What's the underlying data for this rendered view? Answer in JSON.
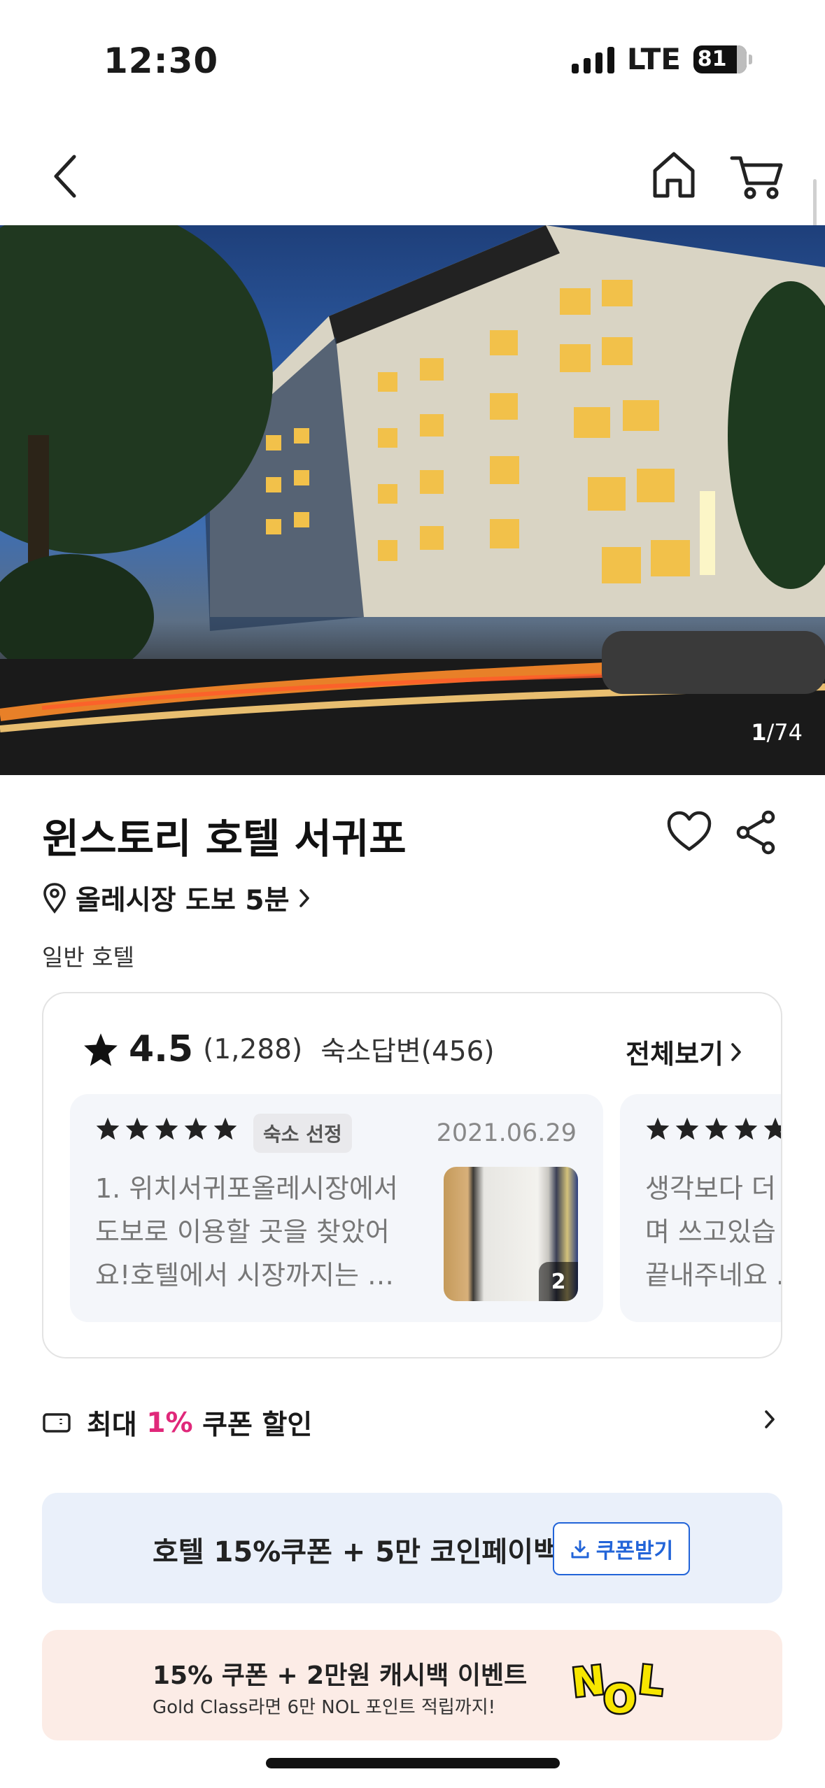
{
  "status_bar": {
    "time": "12:30",
    "network": "LTE",
    "battery": "81"
  },
  "hero": {
    "counter_current": "1",
    "counter_total": "/74"
  },
  "hotel": {
    "name": "윈스토리 호텔 서귀포",
    "location": "올레시장 도보 5분",
    "type": "일반 호텔"
  },
  "reviews": {
    "rating": "4.5",
    "count": "(1,288)",
    "replies": "숙소답변(456)",
    "view_all": "전체보기",
    "items": [
      {
        "badge": "숙소 선정",
        "date": "2021.06.29",
        "text": "1. 위치서귀포올레시장에서 도보로 이용할 곳을 찾았어요!호텔에서 시장까지는 …",
        "photo_count": "2",
        "stars": 5
      },
      {
        "text": "생각보다 더\n며 쓰고있습\n끝내주네요 .",
        "stars": 5
      }
    ]
  },
  "coupon": {
    "prefix": "최대 ",
    "percent": "1%",
    "suffix": " 쿠폰 할인"
  },
  "banner_blue": {
    "text": "호텔 15%쿠폰 + 5만 코인페이백",
    "button": "쿠폰받기"
  },
  "banner_pink": {
    "title": "15% 쿠폰 + 2만원 캐시백 이벤트",
    "subtitle": "Gold Class라면 6만 NOL 포인트 적립까지!",
    "logo_text": "NOL"
  },
  "colors": {
    "accent_pink": "#e0287a",
    "accent_blue": "#2264d8",
    "logo_yellow": "#f7e600"
  }
}
